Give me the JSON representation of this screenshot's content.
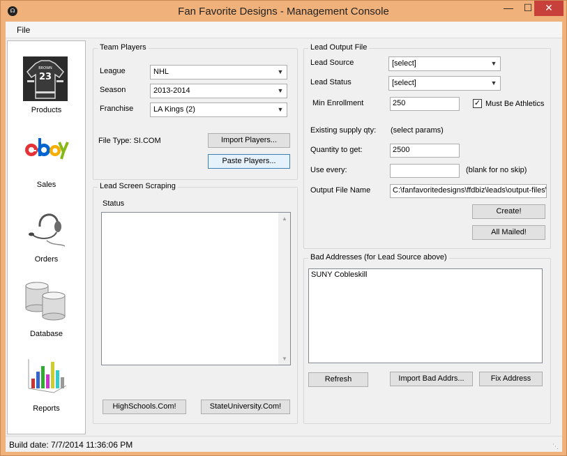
{
  "window": {
    "title": "Fan Favorite Designs - Management Console",
    "minimize": "—",
    "maximize": "☐",
    "close": "✕"
  },
  "menu": {
    "file": "File"
  },
  "nav": {
    "items": [
      {
        "label": "Products",
        "icon": "jersey-icon",
        "jersey_name": "BROWN",
        "jersey_number": "23"
      },
      {
        "label": "Sales",
        "icon": "ebay-logo-icon"
      },
      {
        "label": "Orders",
        "icon": "headset-icon"
      },
      {
        "label": "Database",
        "icon": "database-icon"
      },
      {
        "label": "Reports",
        "icon": "chart-icon"
      }
    ]
  },
  "team_players": {
    "title": "Team Players",
    "league_label": "League",
    "league_value": "NHL",
    "season_label": "Season",
    "season_value": "2013-2014",
    "franchise_label": "Franchise",
    "franchise_value": "LA Kings (2)",
    "file_type": "File Type: SI.COM",
    "import_button": "Import Players...",
    "paste_button": "Paste Players..."
  },
  "scraping": {
    "title": "Lead Screen Scraping",
    "status_label": "Status",
    "status_text": "",
    "highschools_button": "HighSchools.Com!",
    "stateuniversity_button": "StateUniversity.Com!"
  },
  "lead_output": {
    "title": "Lead Output File",
    "source_label": "Lead Source",
    "source_value": "[select]",
    "status_label": "Lead Status",
    "status_value": "[select]",
    "min_enrollment_label": "Min Enrollment",
    "min_enrollment_value": "250",
    "athletics_label": "Must Be Athletics",
    "athletics_checked": "✓",
    "existing_label": "Existing supply qty:",
    "existing_value": "(select params)",
    "quantity_label": "Quantity to get:",
    "quantity_value": "2500",
    "use_every_label": "Use every:",
    "use_every_value": "",
    "use_every_hint": "(blank for no skip)",
    "output_label": "Output File Name",
    "output_value": "C:\\fanfavoritedesigns\\ffdbiz\\leads\\output-files\\",
    "create_button": "Create!",
    "all_mailed_button": "All Mailed!"
  },
  "bad_addresses": {
    "title": "Bad Addresses (for Lead Source above)",
    "items": [
      "SUNY Cobleskill"
    ],
    "refresh_button": "Refresh",
    "import_button": "Import Bad Addrs...",
    "fix_button": "Fix Address"
  },
  "status_bar": {
    "text": "Build date: 7/7/2014 11:36:06 PM"
  }
}
